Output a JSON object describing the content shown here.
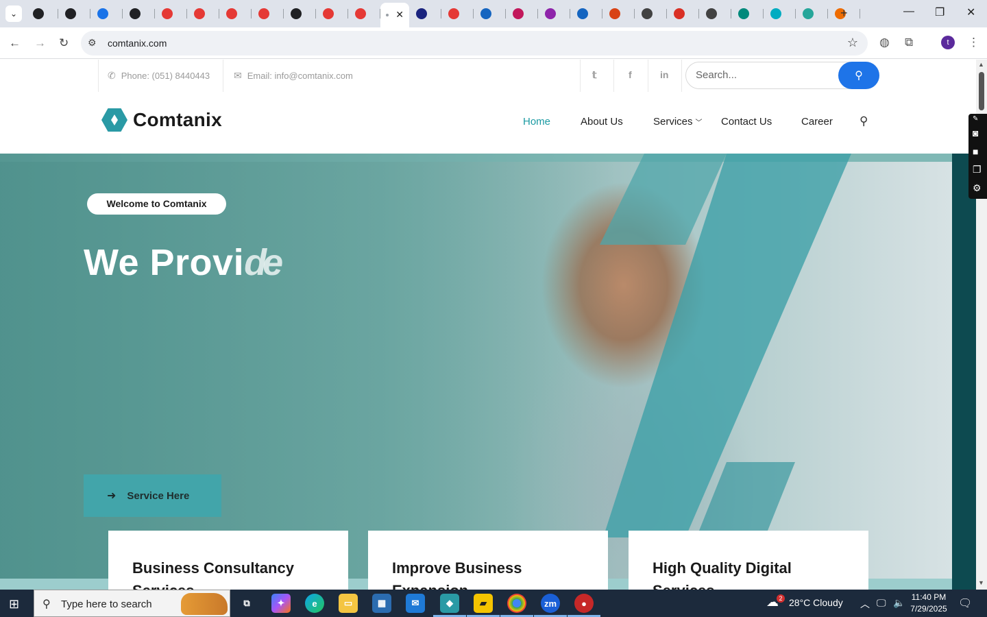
{
  "browser": {
    "tabs": [
      {
        "favicon": "chatgpt-icon",
        "color": "#202124"
      },
      {
        "favicon": "openai-icon",
        "color": "#202124"
      },
      {
        "favicon": "copilot-arc-icon",
        "color": "#1a73e8"
      },
      {
        "favicon": "openai-icon",
        "color": "#202124"
      },
      {
        "favicon": "red-diamond-icon",
        "color": "#e53935"
      },
      {
        "favicon": "red-diamond-icon",
        "color": "#e53935"
      },
      {
        "favicon": "red-diamond-icon",
        "color": "#e53935"
      },
      {
        "favicon": "red-diamond-icon",
        "color": "#e53935"
      },
      {
        "favicon": "v-check-icon",
        "color": "#202124"
      },
      {
        "favicon": "red-diamond-icon",
        "color": "#e53935"
      },
      {
        "favicon": "red-diamond-icon",
        "color": "#e53935"
      },
      {
        "favicon": "active-site-icon",
        "color": "#9aa0a6"
      },
      {
        "favicon": "x-cross-icon",
        "color": "#1a237e"
      },
      {
        "favicon": "red-diamond-icon",
        "color": "#e53935"
      },
      {
        "favicon": "scale-icon",
        "color": "#1565c0"
      },
      {
        "favicon": "pink-blob-icon",
        "color": "#c2185b"
      },
      {
        "favicon": "feather-icon",
        "color": "#8e24aa"
      },
      {
        "favicon": "pulse-icon",
        "color": "#1565c0"
      },
      {
        "favicon": "signature-icon",
        "color": "#d84315"
      },
      {
        "favicon": "globe-icon",
        "color": "#424242"
      },
      {
        "favicon": "gmail-icon",
        "color": "#d93025"
      },
      {
        "favicon": "globe-icon",
        "color": "#424242"
      },
      {
        "favicon": "d-icon",
        "color": "#00897b"
      },
      {
        "favicon": "search-circle-icon",
        "color": "#00acc1"
      },
      {
        "favicon": "teal-orb-icon",
        "color": "#26a69a"
      },
      {
        "favicon": "orange-hand-icon",
        "color": "#ef6c00"
      }
    ],
    "active_tab_index": 11,
    "url": "comtanix.com"
  },
  "site": {
    "topbar": {
      "phone": "Phone: (051) 8440443",
      "email": "Email: info@comtanix.com",
      "social": [
        "twitter-icon",
        "facebook-icon",
        "linkedin-icon"
      ],
      "social_glyphs": [
        "𝕥",
        "f",
        "in"
      ],
      "search_placeholder": "Search..."
    },
    "logo_text": "Comtanix",
    "nav": {
      "home": "Home",
      "about": "About Us",
      "services": "Services",
      "contact": "Contact Us",
      "career": "Career"
    },
    "hero": {
      "badge": "Welcome to Comtanix",
      "title": "We Provi",
      "title_ghost": "de",
      "cta": "Service Here"
    },
    "cards": [
      {
        "title": "Business Consultancy Services"
      },
      {
        "title": "Improve Business Expansion"
      },
      {
        "title": "High Quality Digital Services"
      }
    ]
  },
  "taskbar": {
    "search_text": "Type here to search",
    "weather_badge": "2",
    "weather": "28°C  Cloudy",
    "time": "11:40 PM",
    "date": "7/29/2025"
  },
  "colors": {
    "accent": "#1a9aa2",
    "search_button": "#1e74e8",
    "cta_bg": "#42a5aa"
  }
}
